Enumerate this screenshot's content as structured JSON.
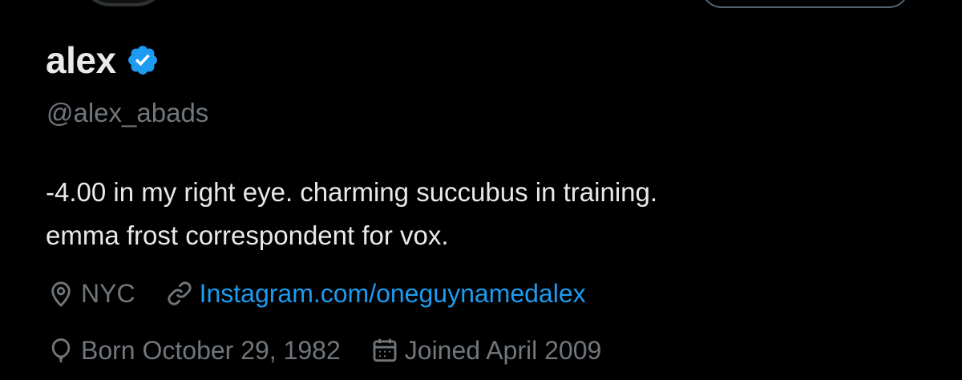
{
  "profile": {
    "display_name": "alex",
    "handle": "@alex_abads",
    "verified": true,
    "bio_lines": [
      "-4.00 in my right eye. charming succubus in training.",
      "emma frost correspondent for vox."
    ],
    "location": "NYC",
    "website": "Instagram.com/oneguynamedalex",
    "birthday": "Born October 29, 1982",
    "joined": "Joined April 2009"
  },
  "colors": {
    "background": "#000000",
    "primary_text": "#e7e9ea",
    "secondary_text": "#71767b",
    "link": "#1d9bf0",
    "verified_badge": "#1d9bf0"
  },
  "icons": {
    "verified": "verified-badge-icon",
    "location": "location-pin-icon",
    "website": "link-icon",
    "birthday": "balloon-icon",
    "joined": "calendar-icon"
  }
}
